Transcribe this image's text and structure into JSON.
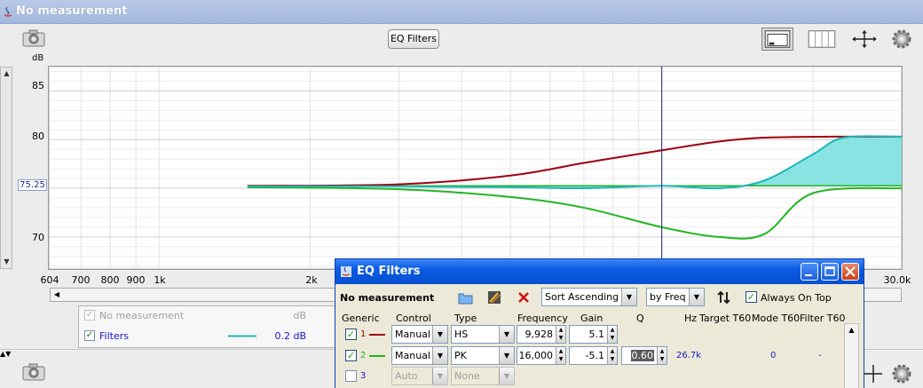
{
  "window": {
    "title": "No measurement"
  },
  "toolbar": {
    "eq_filters_label": "EQ Filters"
  },
  "y_axis": {
    "unit": "dB",
    "ticks": [
      "85",
      "80",
      "75.25",
      "70"
    ],
    "current": "75.25"
  },
  "x_axis": {
    "ticks": [
      "604",
      "700",
      "800",
      "900",
      "1k",
      "2k",
      "30.0k Hz"
    ]
  },
  "legend": {
    "header": {
      "name": "No measurement",
      "unit": "dB"
    },
    "items": [
      {
        "name": "Filters",
        "value": "0.2 dB",
        "color": "#1fb7b7"
      }
    ]
  },
  "colors": {
    "filter1": "#a00010",
    "filter2": "#22b522",
    "combined": "#1fb7b7",
    "fill": "#7de0e0",
    "cursor": "#202080"
  },
  "chart_data": {
    "type": "line",
    "xlabel": "",
    "ylabel": "dB",
    "x_scale": "log",
    "xlim": [
      604,
      30000
    ],
    "ylim": [
      66.7,
      87.5
    ],
    "cursor_hz": 10000,
    "series": [
      {
        "name": "1",
        "x": [
          1500,
          3000,
          5000,
          7000,
          10000,
          13000,
          16000,
          22000,
          30000
        ],
        "values": [
          75.25,
          75.4,
          76.3,
          77.6,
          78.9,
          79.8,
          80.2,
          80.3,
          80.3
        ]
      },
      {
        "name": "2",
        "x": [
          1500,
          3000,
          5000,
          7000,
          10000,
          13000,
          16000,
          20000,
          30000
        ],
        "values": [
          75.1,
          74.9,
          74.1,
          73.0,
          71.0,
          70.0,
          70.3,
          74.5,
          75.0
        ]
      },
      {
        "x": [
          1500,
          3000,
          5000,
          7000,
          10000,
          13000,
          16000,
          20000,
          23000,
          30000
        ],
        "values": [
          75.2,
          75.2,
          75.1,
          75.0,
          75.25,
          75.0,
          75.8,
          78.5,
          80.2,
          80.3
        ]
      }
    ]
  },
  "dialog": {
    "title": "EQ Filters",
    "measurement": "No measurement",
    "sort": "Sort Ascending",
    "by": "by Freq",
    "always_on_top": "Always On Top",
    "headers": {
      "generic": "Generic",
      "control": "Control",
      "type": "Type",
      "frequency": "Frequency",
      "gain": "Gain",
      "q": "Q",
      "hz": "Hz",
      "target_t60": "Target T60",
      "mode_t60": "Mode T60",
      "filter_t60": "Filter T60"
    },
    "rows": [
      {
        "num": "1",
        "control": "Manual",
        "type": "HS",
        "frequency": "9,928",
        "gain": "5.1",
        "q": "",
        "hz": "",
        "mode": "",
        "filter": ""
      },
      {
        "num": "2",
        "control": "Manual",
        "type": "PK",
        "frequency": "16,000",
        "gain": "-5.1",
        "q": "0.60",
        "hz": "26.7k",
        "mode": "0",
        "filter": "-"
      },
      {
        "num": "3",
        "control": "Auto",
        "type": "None"
      }
    ]
  }
}
